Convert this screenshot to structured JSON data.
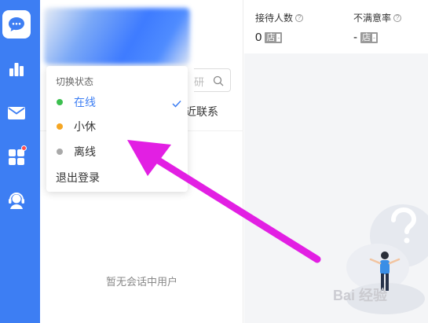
{
  "sidebar": {
    "items": [
      {
        "icon": "chat-bubble-icon",
        "active": true
      },
      {
        "icon": "bar-chart-icon",
        "active": false
      },
      {
        "icon": "mail-icon",
        "active": false
      },
      {
        "icon": "apps-grid-icon",
        "active": false,
        "badge": true
      },
      {
        "icon": "headset-service-icon",
        "active": false
      }
    ]
  },
  "search": {
    "partial_text": "研"
  },
  "tabs": {
    "partial_label": "近联系"
  },
  "status_menu": {
    "title": "切换状态",
    "options": [
      {
        "label": "在线",
        "color": "#3cbf4f",
        "selected": true
      },
      {
        "label": "小休",
        "color": "#f5a623",
        "selected": false
      },
      {
        "label": "离线",
        "color": "#a9a9a9",
        "selected": false
      }
    ],
    "logout_label": "退出登录"
  },
  "conversation_list": {
    "empty_text": "暂无会话中用户"
  },
  "stats": {
    "reception": {
      "label": "接待人数",
      "value": "0",
      "unit": "店"
    },
    "dissatisfaction": {
      "label": "不满意率",
      "value": "-",
      "unit": "店"
    }
  },
  "watermark": {
    "text": "Bai 经验"
  },
  "colors": {
    "accent": "#3d7ef3",
    "annotation": "#e21fe3"
  }
}
